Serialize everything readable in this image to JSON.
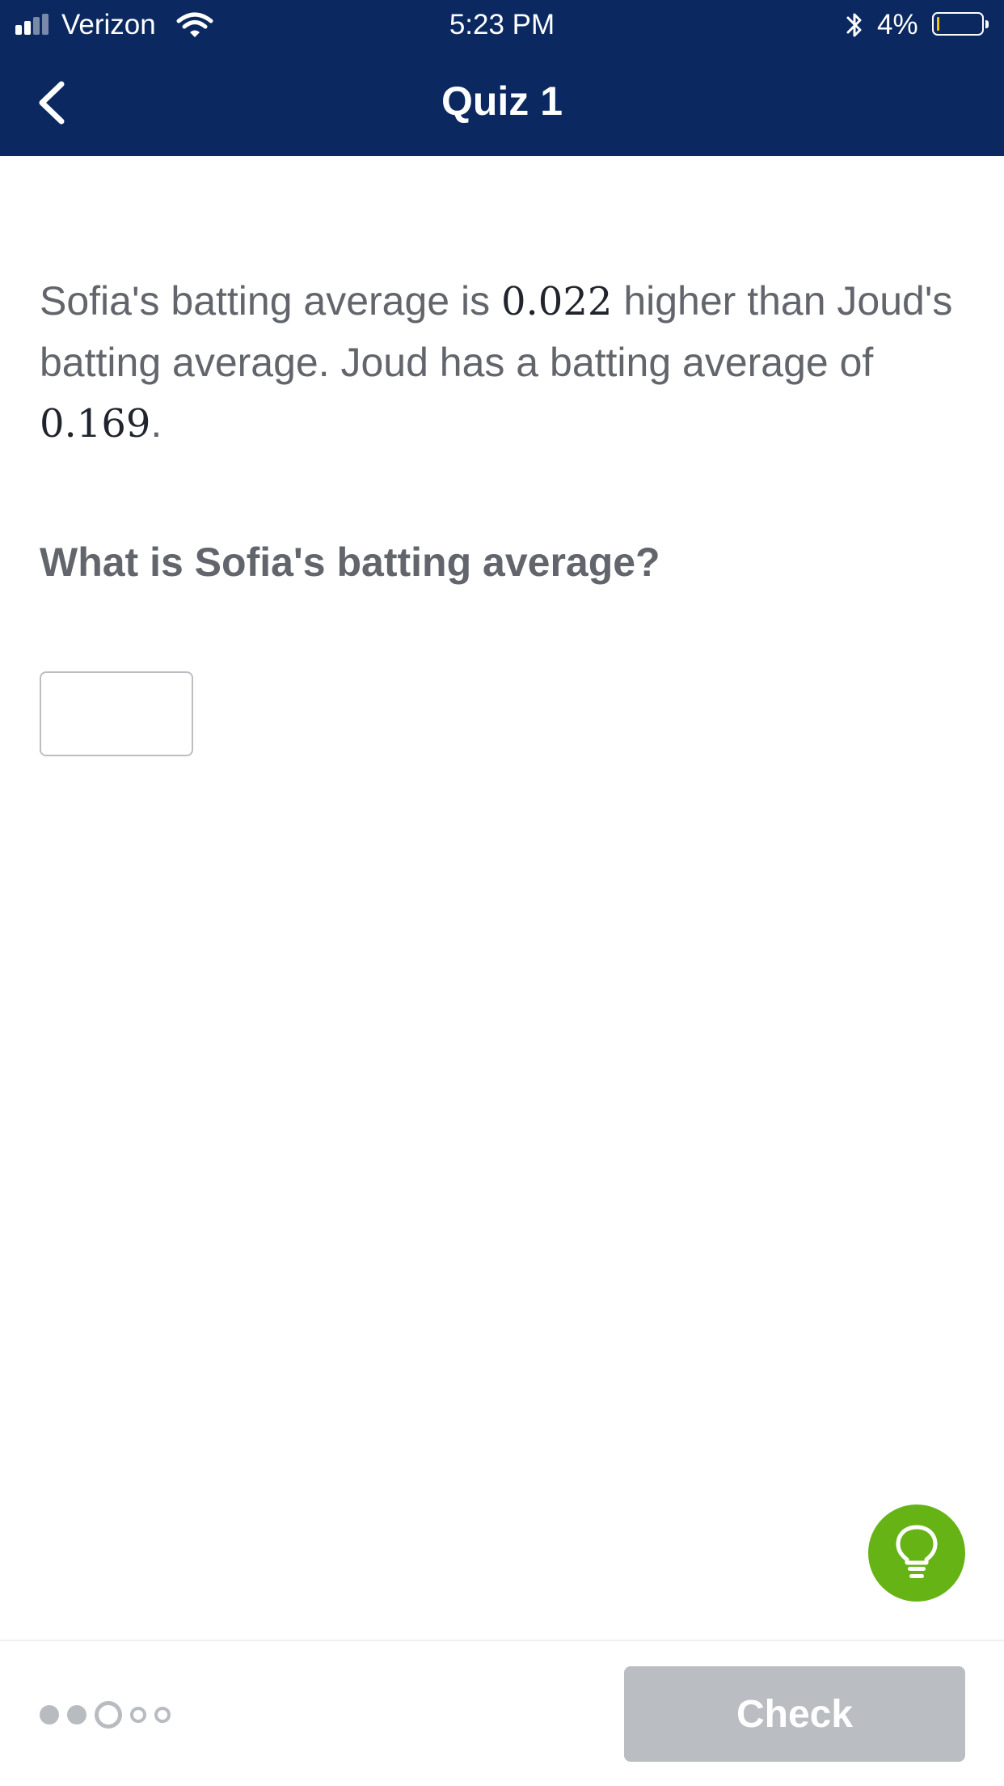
{
  "status_bar": {
    "carrier": "Verizon",
    "time": "5:23 PM",
    "battery_percent": "4%"
  },
  "nav": {
    "title": "Quiz 1",
    "back_icon": "chevron-left-icon"
  },
  "problem": {
    "text_1": "Sofia's batting average is ",
    "value_1": "0.022",
    "text_2": " higher than Joud's batting average. Joud has a batting average of ",
    "value_2": "0.169",
    "text_3": "."
  },
  "question": "What is Sofia's batting average?",
  "answer": {
    "value": "",
    "placeholder": ""
  },
  "hint_icon": "lightbulb-icon",
  "progress": {
    "total": 5,
    "completed": 2,
    "current": 3
  },
  "check_button": {
    "label": "Check",
    "enabled": false
  },
  "colors": {
    "header": "#0b2960",
    "hint": "#66b315",
    "check_disabled": "#babec2",
    "text": "#62656b"
  }
}
